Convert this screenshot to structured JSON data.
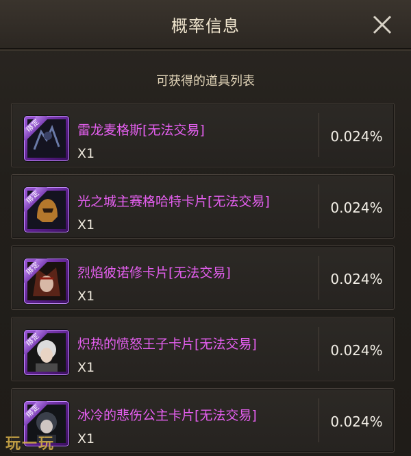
{
  "window": {
    "title": "概率信息",
    "subtitle": "可获得的道具列表"
  },
  "items": [
    {
      "name": "雷龙麦格斯[无法交易]",
      "qty": "X1",
      "probability": "0.024%",
      "badge": "绑定",
      "icon": "thunder-dragon-icon"
    },
    {
      "name": "光之城主赛格哈特卡片[无法交易]",
      "qty": "X1",
      "probability": "0.024%",
      "badge": "绑定",
      "icon": "helmet-knight-icon"
    },
    {
      "name": "烈焰彼诺修卡片[无法交易]",
      "qty": "X1",
      "probability": "0.024%",
      "badge": "绑定",
      "icon": "flame-warrior-icon"
    },
    {
      "name": "炽热的愤怒王子卡片[无法交易]",
      "qty": "X1",
      "probability": "0.024%",
      "badge": "绑定",
      "icon": "prince-portrait-icon"
    },
    {
      "name": "冰冷的悲伤公主卡片[无法交易]",
      "qty": "X1",
      "probability": "0.024%",
      "badge": "绑定",
      "icon": "princess-portrait-icon"
    }
  ],
  "watermark": "玩一玩",
  "colors": {
    "item_name": "#e55ff0",
    "frame_purple": "#9a58d6",
    "background": "#221f1b"
  }
}
